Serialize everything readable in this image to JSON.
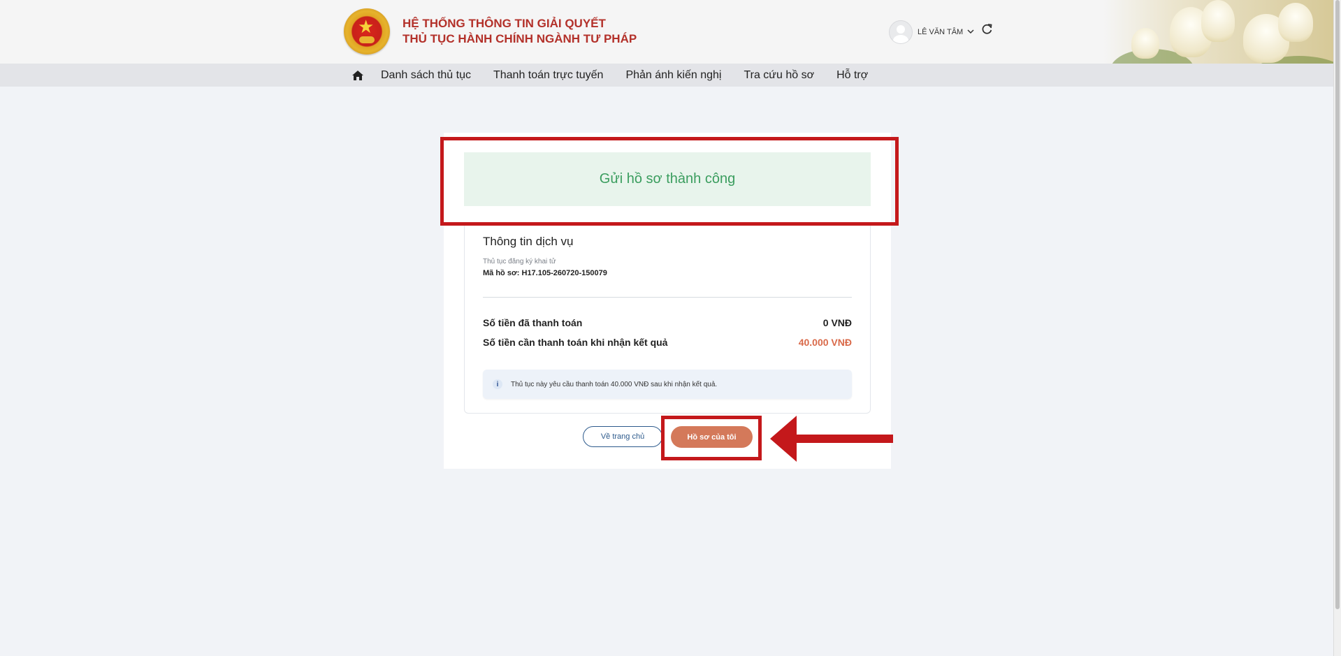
{
  "header": {
    "title_line1": "HỆ THỐNG THÔNG TIN GIẢI QUYẾT",
    "title_line2": "THỦ TỤC HÀNH CHÍNH NGÀNH TƯ PHÁP",
    "user_name": "LÊ VĂN TÂM",
    "icons": [
      "national-emblem",
      "avatar",
      "chevron-down-icon",
      "refresh-icon"
    ]
  },
  "nav": {
    "items": [
      {
        "label": "Danh sách thủ tục"
      },
      {
        "label": "Thanh toán trực tuyến"
      },
      {
        "label": "Phản ánh kiến nghị"
      },
      {
        "label": "Tra cứu hồ sơ"
      },
      {
        "label": "Hỗ trợ"
      }
    ]
  },
  "result": {
    "success_message": "Gửi hồ sơ thành công"
  },
  "service": {
    "title": "Thông tin dịch vụ",
    "procedure_name": "Thủ tục đăng ký khai tử",
    "file_code_label": "Mã hồ sơ: ",
    "file_code": "H17.105-260720-150079",
    "paid_label": "Số tiền đã thanh toán",
    "paid_value": "0 VNĐ",
    "due_label": "Số tiền cần thanh toán khi nhận kết quả",
    "due_value": "40.000 VNĐ",
    "notice": "Thủ tục này yêu cầu thanh toán 40.000 VNĐ sau khi nhận kết quả."
  },
  "buttons": {
    "home": "Về trang chủ",
    "my_files": "Hồ sơ của tôi"
  },
  "colors": {
    "brand_red": "#b3312a",
    "success_green": "#3a9d5e",
    "amount_orange": "#d96a4a",
    "primary_button": "#d4795a",
    "annotation_red": "#c4181b"
  }
}
